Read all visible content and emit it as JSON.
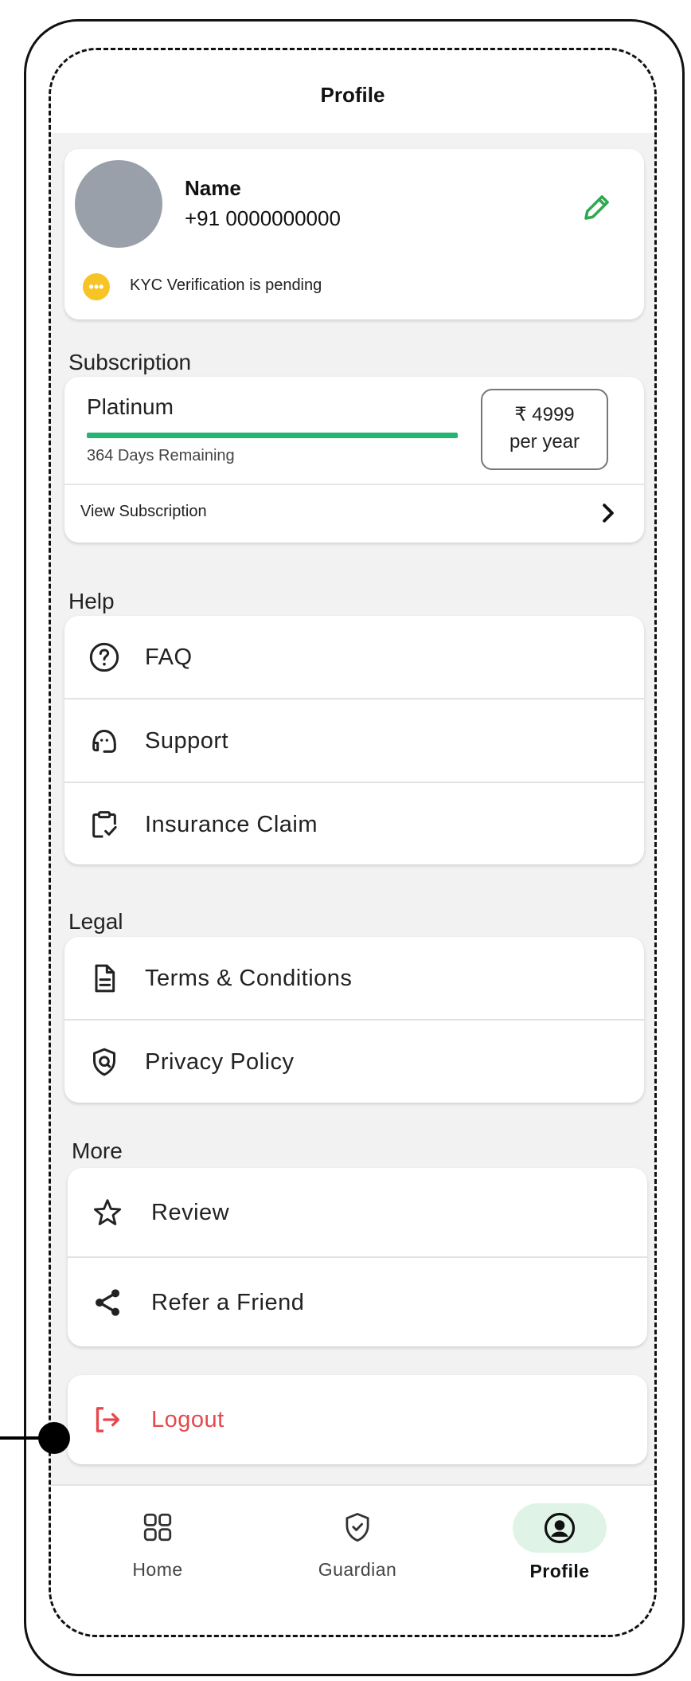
{
  "header": {
    "title": "Profile"
  },
  "profile": {
    "name": "Name",
    "phone": "+91 0000000000",
    "kyc_status": "KYC Verification is pending",
    "kyc_icon": "ellipsis-badge-icon",
    "edit_icon": "pencil-icon"
  },
  "subscription": {
    "section_title": "Subscription",
    "plan": "Platinum",
    "progress_fraction": 1.0,
    "progress_color": "#22b573",
    "remaining": "364 Days Remaining",
    "price": "₹ 4999",
    "period": "per year",
    "view_label": "View Subscription"
  },
  "help": {
    "section_title": "Help",
    "items": [
      {
        "label": "FAQ",
        "icon": "question-circle-icon"
      },
      {
        "label": "Support",
        "icon": "headset-icon"
      },
      {
        "label": "Insurance Claim",
        "icon": "clipboard-check-icon"
      }
    ]
  },
  "legal": {
    "section_title": "Legal",
    "items": [
      {
        "label": "Terms & Conditions",
        "icon": "document-icon"
      },
      {
        "label": "Privacy Policy",
        "icon": "shield-lock-icon"
      }
    ]
  },
  "more": {
    "section_title": "More",
    "items": [
      {
        "label": "Review",
        "icon": "star-outline-icon"
      },
      {
        "label": "Refer a Friend",
        "icon": "share-icon"
      }
    ]
  },
  "logout": {
    "label": "Logout",
    "icon": "logout-icon",
    "color": "#e5484d"
  },
  "bottom_nav": {
    "items": [
      {
        "label": "Home",
        "icon": "grid-icon"
      },
      {
        "label": "Guardian",
        "icon": "shield-check-icon"
      },
      {
        "label": "Profile",
        "icon": "user-circle-icon",
        "active": true
      }
    ],
    "active_bg": "#dff4e6"
  },
  "colors": {
    "background": "#f2f2f2",
    "accent_green": "#22b573",
    "kyc_yellow": "#f7c325"
  }
}
